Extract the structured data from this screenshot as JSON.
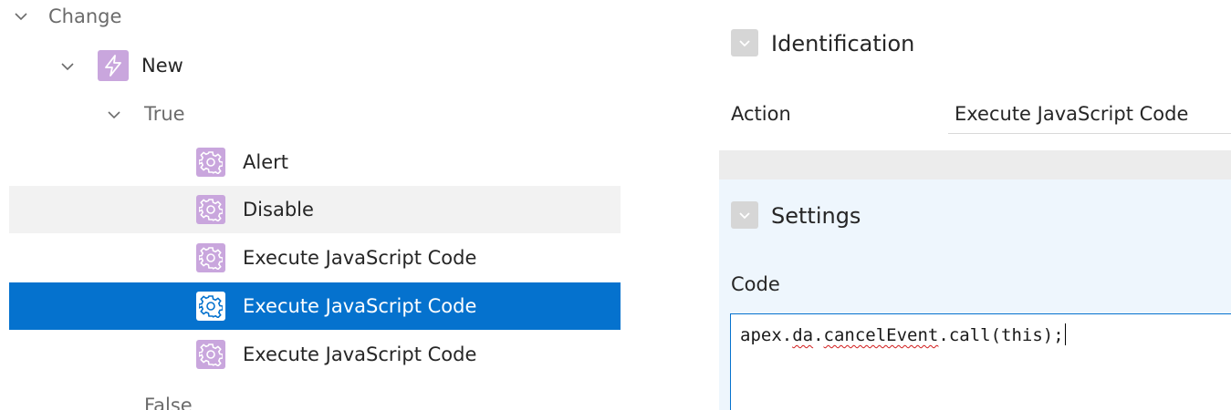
{
  "tree": {
    "event_label": "Change",
    "action_label": "New",
    "true_label": "True",
    "false_label": "False",
    "true_actions": [
      {
        "label": "Alert",
        "icon": "gear-icon"
      },
      {
        "label": "Disable",
        "icon": "gear-icon"
      },
      {
        "label": "Execute JavaScript Code",
        "icon": "gear-icon"
      },
      {
        "label": "Execute JavaScript Code",
        "icon": "gear-icon",
        "selected": true
      },
      {
        "label": "Execute JavaScript Code",
        "icon": "gear-icon"
      }
    ],
    "action_icon": "lightning-bolt-icon"
  },
  "props": {
    "identification": {
      "title": "Identification",
      "action_label": "Action",
      "action_value": "Execute JavaScript Code"
    },
    "settings": {
      "title": "Settings",
      "code_label": "Code",
      "code_value": "apex.da.cancelEvent.call(this);",
      "code_parts": [
        "apex.",
        "da",
        ".",
        "cancelEvent",
        ".call(this);"
      ]
    }
  },
  "colors": {
    "selection": "#0572ce",
    "node_icon": "#c9a6dd",
    "settings_bg": "#eef6fd",
    "section_checkbox": "#d6d6d6"
  }
}
